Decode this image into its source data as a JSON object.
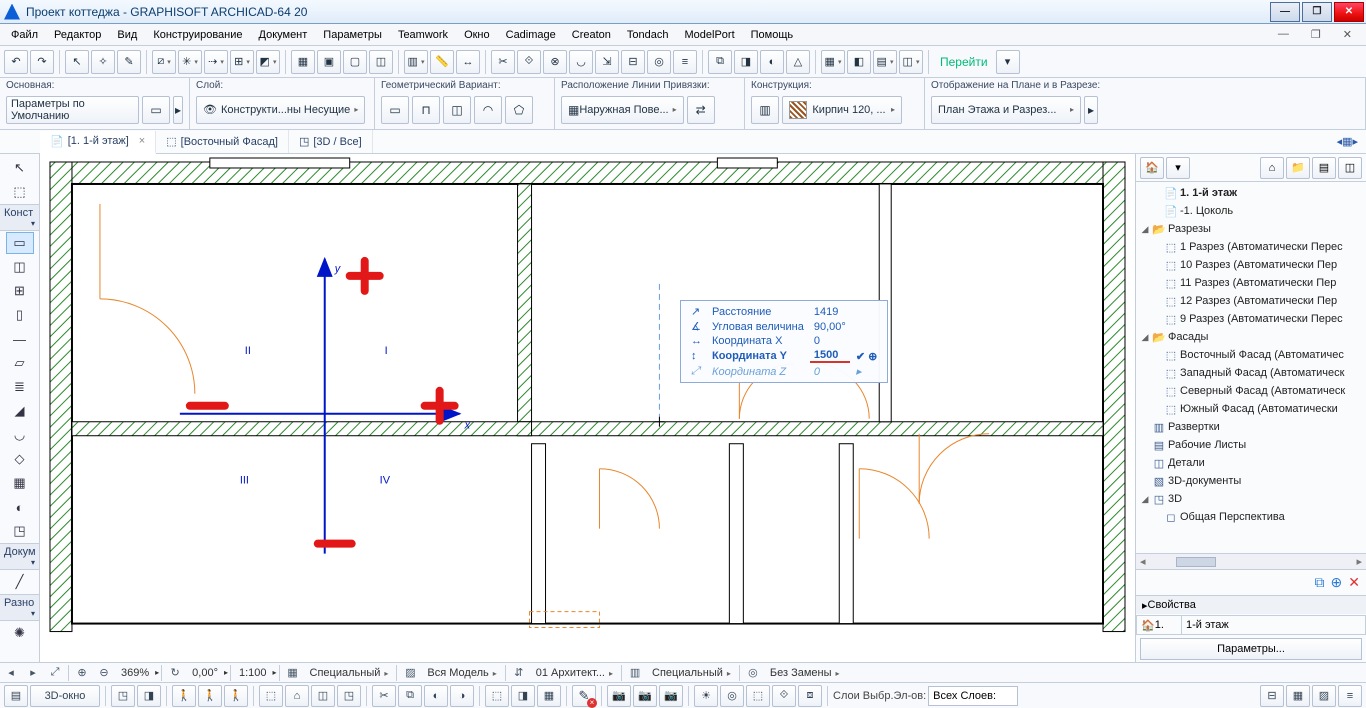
{
  "title": "Проект коттеджа - GRAPHISOFT ARCHICAD-64 20",
  "menu": [
    "Файл",
    "Редактор",
    "Вид",
    "Конструирование",
    "Документ",
    "Параметры",
    "Teamwork",
    "Окно",
    "Cadimage",
    "Creaton",
    "Tondach",
    "ModelPort",
    "Помощь"
  ],
  "goto": "Перейти",
  "infobox": {
    "main_label": "Основная:",
    "main_value": "Параметры по Умолчанию",
    "layer_label": "Слой:",
    "layer_value": "Конструкти...ны Несущие",
    "geom_label": "Геометрический Вариант:",
    "refline_label": "Расположение Линии Привязки:",
    "refline_value": "Наружная Пове...",
    "struct_label": "Конструкция:",
    "struct_value": "Кирпич 120, ...",
    "plan_label": "Отображение на Плане и в Разрезе:",
    "plan_value": "План Этажа и Разрез..."
  },
  "tabs": {
    "t1": "[1. 1-й этаж]",
    "t2": "[Восточный Фасад]",
    "t3": "[3D / Все]"
  },
  "toolbox": {
    "g1": "Конст",
    "g2": "Докум",
    "g3": "Разно"
  },
  "tracker": {
    "dist_lbl": "Расстояние",
    "dist_val": "1419",
    "ang_lbl": "Угловая величина",
    "ang_val": "90,00°",
    "x_lbl": "Координата X",
    "x_val": "0",
    "y_lbl": "Координата Y",
    "y_val": "1500",
    "z_lbl": "Координата Z",
    "z_val": "0"
  },
  "nav": {
    "items": [
      {
        "ind": 1,
        "ico": "📄",
        "label": "1. 1-й этаж",
        "bold": true
      },
      {
        "ind": 1,
        "ico": "📄",
        "label": "-1. Цоколь"
      },
      {
        "ind": 0,
        "tw": "◢",
        "ico": "📂",
        "label": "Разрезы"
      },
      {
        "ind": 1,
        "ico": "⬚",
        "label": "1 Разрез (Автоматически Перес"
      },
      {
        "ind": 1,
        "ico": "⬚",
        "label": "10 Разрез (Автоматически Пер"
      },
      {
        "ind": 1,
        "ico": "⬚",
        "label": "11 Разрез (Автоматически Пер"
      },
      {
        "ind": 1,
        "ico": "⬚",
        "label": "12 Разрез (Автоматически Пер"
      },
      {
        "ind": 1,
        "ico": "⬚",
        "label": "9 Разрез (Автоматически Перес"
      },
      {
        "ind": 0,
        "tw": "◢",
        "ico": "📂",
        "label": "Фасады"
      },
      {
        "ind": 1,
        "ico": "⬚",
        "label": "Восточный Фасад (Автоматичес"
      },
      {
        "ind": 1,
        "ico": "⬚",
        "label": "Западный Фасад (Автоматическ"
      },
      {
        "ind": 1,
        "ico": "⬚",
        "label": "Северный Фасад (Автоматическ"
      },
      {
        "ind": 1,
        "ico": "⬚",
        "label": "Южный Фасад (Автоматически"
      },
      {
        "ind": 0,
        "tw": "",
        "ico": "▥",
        "label": "Развертки"
      },
      {
        "ind": 0,
        "tw": "",
        "ico": "▤",
        "label": "Рабочие Листы"
      },
      {
        "ind": 0,
        "tw": "",
        "ico": "◫",
        "label": "Детали"
      },
      {
        "ind": 0,
        "tw": "",
        "ico": "▧",
        "label": "3D-документы"
      },
      {
        "ind": 0,
        "tw": "◢",
        "ico": "◳",
        "label": "3D"
      },
      {
        "ind": 1,
        "ico": "◻",
        "label": "Общая Перспектива"
      }
    ],
    "prop_hdr": "Свойства",
    "prop_id": "1.",
    "prop_name": "1-й этаж",
    "prop_btn": "Параметры..."
  },
  "status": {
    "zoom": "369%",
    "angle": "0,00°",
    "scale": "1:100",
    "opt1": "Специальный",
    "opt2": "Вся Модель",
    "opt3": "01 Архитект...",
    "opt4": "Специальный",
    "opt5": "Без Замены"
  },
  "bottom": {
    "win3d": "3D-окно",
    "layers_lbl": "Слои Выбр.Эл-ов:",
    "layers_val": "Всех Слоев:"
  },
  "quadrants": {
    "q1": "I",
    "q2": "II",
    "q3": "III",
    "q4": "IV",
    "xl": "x",
    "yl": "y"
  }
}
